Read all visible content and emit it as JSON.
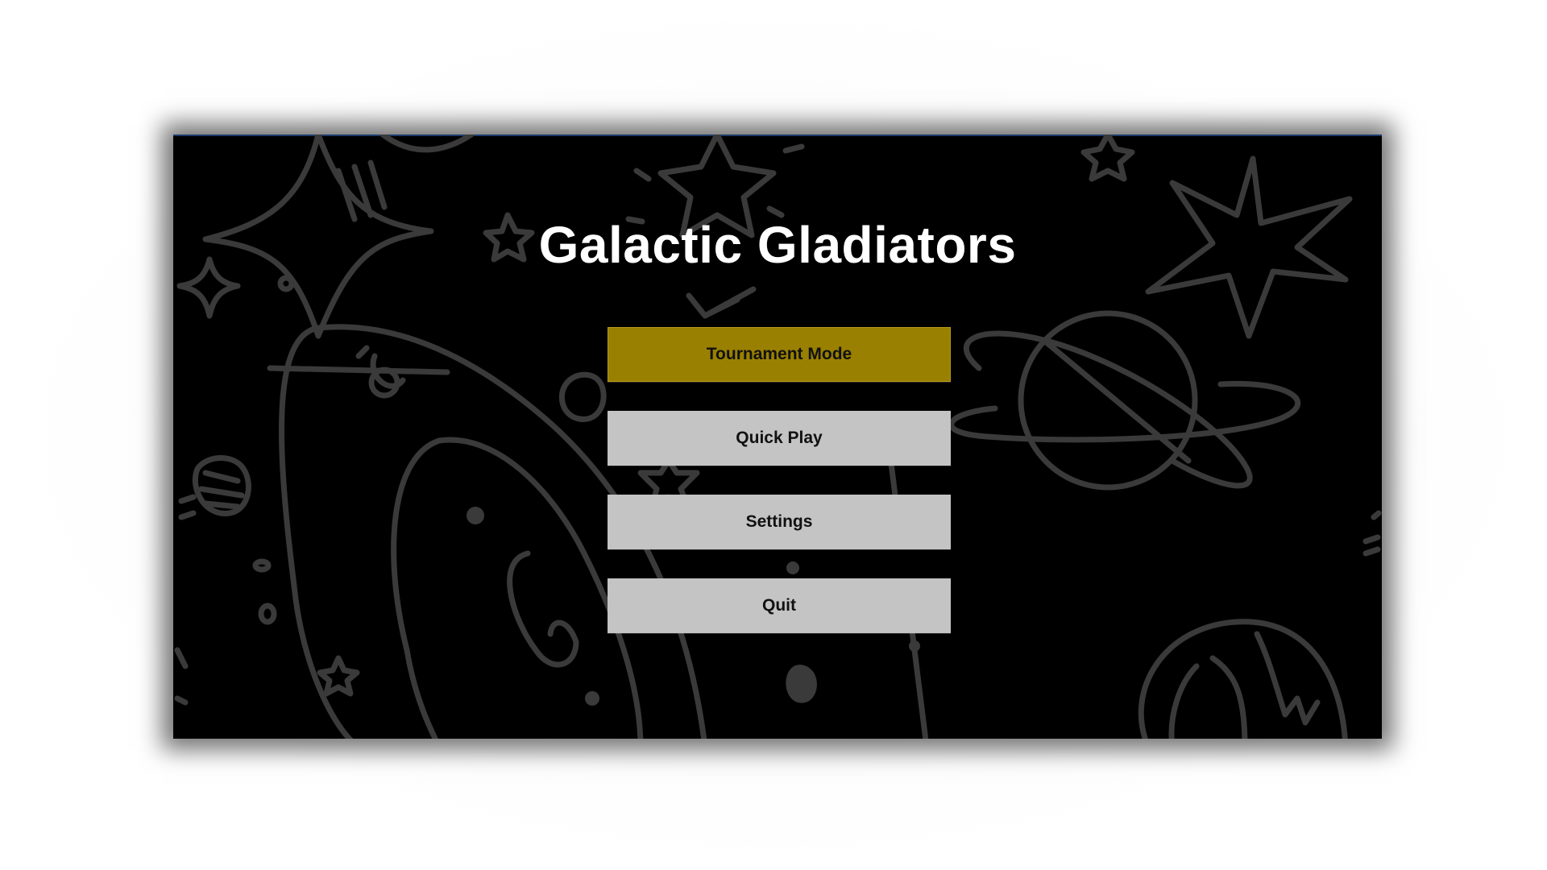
{
  "game": {
    "title": "Galactic Gladiators"
  },
  "menu": {
    "items": [
      {
        "label": "Tournament Mode",
        "selected": true
      },
      {
        "label": "Quick Play",
        "selected": false
      },
      {
        "label": "Settings",
        "selected": false
      },
      {
        "label": "Quit",
        "selected": false
      }
    ]
  },
  "colors": {
    "background": "#000000",
    "doodle": "#3a3a3a",
    "selected_button": "#9a8000",
    "button": "#c4c4c4",
    "title": "#ffffff"
  }
}
